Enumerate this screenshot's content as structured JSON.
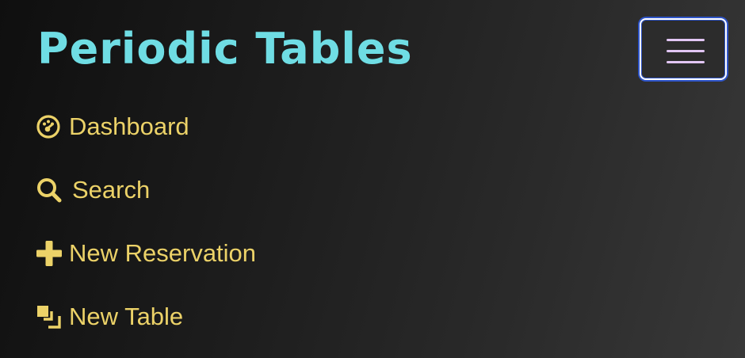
{
  "header": {
    "brand": "Periodic Tables",
    "menu_toggle": {
      "icon": "hamburger-menu-icon"
    }
  },
  "nav": {
    "items": [
      {
        "label": "Dashboard",
        "icon": "dashboard-gauge-icon"
      },
      {
        "label": "Search",
        "icon": "search-icon"
      },
      {
        "label": "New Reservation",
        "icon": "plus-icon"
      },
      {
        "label": "New Table",
        "icon": "stacked-squares-icon"
      }
    ]
  },
  "colors": {
    "brand": "#6fdde4",
    "nav_text": "#ecd268",
    "toggle_lines": "#e2c6f4",
    "toggle_focus_ring": "#2f55c9"
  }
}
